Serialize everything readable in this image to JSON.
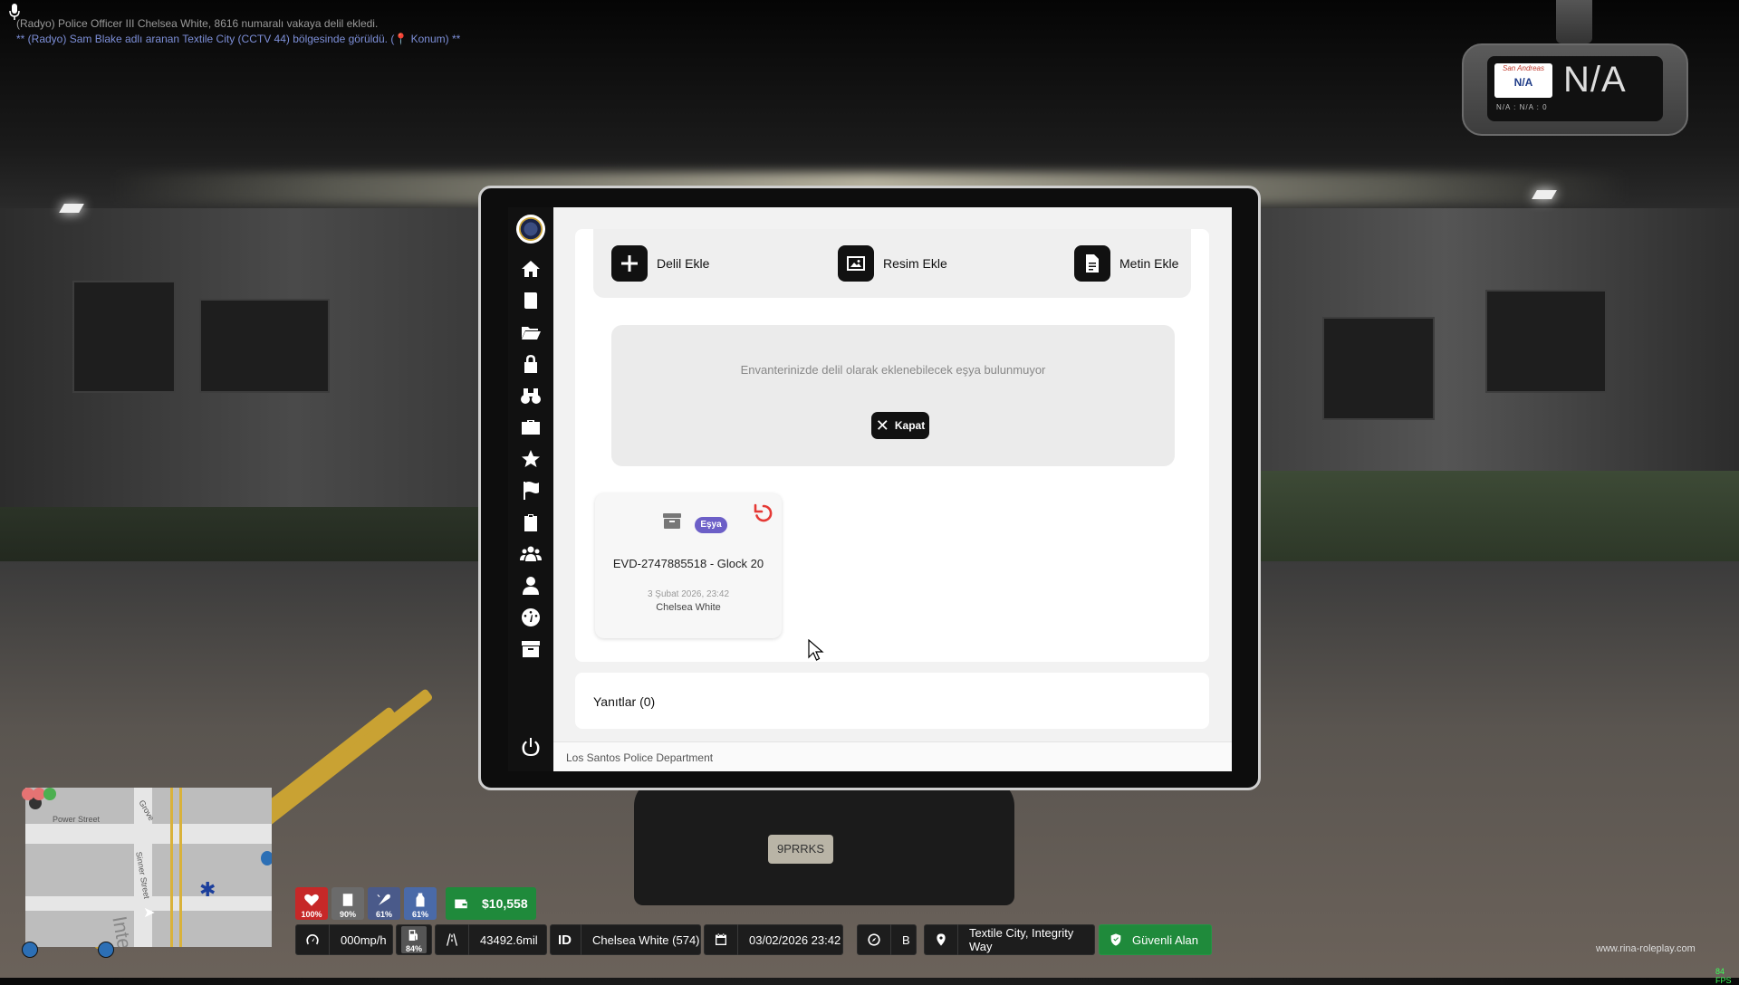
{
  "chat": {
    "lines": [
      "(Radyo) Police Officer III Chelsea White, 8616 numaralı vakaya delil ekledi.",
      "** (Radyo) Sam Blake adlı aranan Textile City (CCTV 44) bölgesinde görüldü. (📍 Konum) **"
    ]
  },
  "dashcam": {
    "plate_state": "San Andreas",
    "plate_number": "N/A",
    "display": "N/A",
    "sub": "N/A : N/A : 0"
  },
  "tablet": {
    "sidebar": {
      "items": [
        "home-icon",
        "report-icon",
        "folder-icon",
        "lock-icon",
        "binoculars-icon",
        "briefcase-icon",
        "star-icon",
        "flag-icon",
        "clipboard-icon",
        "users-icon",
        "user-icon",
        "dashboard-icon",
        "archive-icon",
        "power-icon"
      ]
    },
    "toolbar": {
      "add_evidence": "Delil Ekle",
      "add_image": "Resim Ekle",
      "add_text": "Metin Ekle"
    },
    "empty_message": "Envanterinizde delil olarak eklenebilecek eşya bulunmuyor",
    "close_label": "Kapat",
    "evidence_card": {
      "badge": "Eşya",
      "title": "EVD-2747885518 - Glock 20",
      "date": "3 Şubat 2026, 23:42",
      "author": "Chelsea White"
    },
    "replies_label": "Yanıtlar (0)",
    "footer": "Los Santos Police Department"
  },
  "hud": {
    "health": "100%",
    "armor": "90%",
    "hunger": "61%",
    "thirst": "61%",
    "money": "$10,558",
    "speed": "000mp/h",
    "fuel": "84%",
    "odometer": "43492.6mil",
    "id_label": "ID",
    "player": "Chelsea White (574)",
    "datetime": "03/02/2026 23:42",
    "direction": "B",
    "location": "Textile City, Integrity Way",
    "zone": "Güvenli Alan"
  },
  "minimap": {
    "streets": [
      "Power Street",
      "Sinner Street",
      "Grove",
      "Inte"
    ]
  },
  "watermark": "www.rina-roleplay.com",
  "fps": "84 FPS",
  "colors": {
    "health": "#c62828",
    "armor": "#6b6b6b",
    "hunger": "#4a5a8a",
    "thirst": "#4a6aa8",
    "money": "#1f8a3b",
    "badge": "#6c5fc7",
    "undo": "#e53935",
    "chat_radio": "#7d8fd8"
  }
}
